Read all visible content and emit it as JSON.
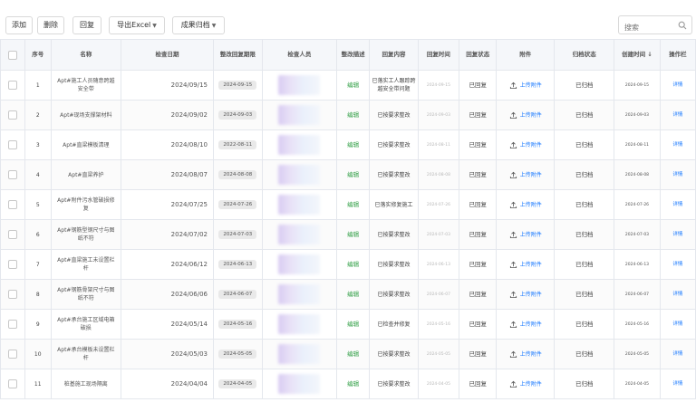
{
  "toolbar": {
    "add_label": "添加",
    "delete_label": "删除",
    "reply_label": "回复",
    "export_label": "导出Excel",
    "archive_label": "成果归档",
    "search_placeholder": "搜索"
  },
  "table": {
    "headers": {
      "index": "序号",
      "name": "名称",
      "check_date": "检查日期",
      "deadline": "整改回复期限",
      "inspector": "检查人员",
      "description": "整改描述",
      "reply_content": "回复内容",
      "reply_time": "回复时间",
      "reply_status": "回复状态",
      "attachment": "附件",
      "archive_status": "归档状态",
      "create_time": "创建时间 ↓",
      "actions": "操作栏"
    },
    "rows": [
      {
        "index": "1",
        "name": "Apt#施工人员随意跨越安全带",
        "check_date": "2024/09/15",
        "deadline": "2024-09-15",
        "description": "编辑",
        "reply": "已落实工人跟踪跨越安全带问题",
        "reply_time": "2024-09-15",
        "status": "已回复",
        "attachment": "上传附件",
        "archive": "已归档",
        "created": "2024-09-15",
        "action": "详情"
      },
      {
        "index": "2",
        "name": "Apt#现场支撑架材料",
        "check_date": "2024/09/02",
        "deadline": "2024-09-03",
        "description": "编辑",
        "reply": "已按要求整改",
        "reply_time": "2024-09-03",
        "status": "已回复",
        "attachment": "上传附件",
        "archive": "已归档",
        "created": "2024-09-03",
        "action": "详情"
      },
      {
        "index": "3",
        "name": "Apt#直梁模板清理",
        "check_date": "2024/08/10",
        "deadline": "2022-08-11",
        "description": "编辑",
        "reply": "已按要求整改",
        "reply_time": "2024-08-11",
        "status": "已回复",
        "attachment": "上传附件",
        "archive": "已归档",
        "created": "2024-08-11",
        "action": "详情"
      },
      {
        "index": "4",
        "name": "Apt#直梁养护",
        "check_date": "2024/08/07",
        "deadline": "2024-08-08",
        "description": "编辑",
        "reply": "已按要求整改",
        "reply_time": "2024-08-08",
        "status": "已回复",
        "attachment": "上传附件",
        "archive": "已归档",
        "created": "2024-08-08",
        "action": "详情"
      },
      {
        "index": "5",
        "name": "Apt#附件污水管破损修复",
        "check_date": "2024/07/25",
        "deadline": "2024-07-26",
        "description": "编辑",
        "reply": "已落实修复施工",
        "reply_time": "2024-07-26",
        "status": "已回复",
        "attachment": "上传附件",
        "archive": "已归档",
        "created": "2024-07-26",
        "action": "详情"
      },
      {
        "index": "6",
        "name": "Apt#钢筋型钢尺寸与图纸不符",
        "check_date": "2024/07/02",
        "deadline": "2024-07-03",
        "description": "编辑",
        "reply": "已按要求整改",
        "reply_time": "2024-07-03",
        "status": "已回复",
        "attachment": "上传附件",
        "archive": "已归档",
        "created": "2024-07-03",
        "action": "详情"
      },
      {
        "index": "7",
        "name": "Apt#直梁施工未设置栏杆",
        "check_date": "2024/06/12",
        "deadline": "2024-06-13",
        "description": "编辑",
        "reply": "已按要求整改",
        "reply_time": "2024-06-13",
        "status": "已回复",
        "attachment": "上传附件",
        "archive": "已归档",
        "created": "2024-06-13",
        "action": "详情"
      },
      {
        "index": "8",
        "name": "Apt#钢筋骨架尺寸与图纸不符",
        "check_date": "2024/06/06",
        "deadline": "2024-06-07",
        "description": "编辑",
        "reply": "已按要求整改",
        "reply_time": "2024-06-07",
        "status": "已回复",
        "attachment": "上传附件",
        "archive": "已归档",
        "created": "2024-06-07",
        "action": "详情"
      },
      {
        "index": "9",
        "name": "Apt#承台施工区域电箱破损",
        "check_date": "2024/05/14",
        "deadline": "2024-05-16",
        "description": "编辑",
        "reply": "已检查并修复",
        "reply_time": "2024-05-16",
        "status": "已回复",
        "attachment": "上传附件",
        "archive": "已归档",
        "created": "2024-05-16",
        "action": "详情"
      },
      {
        "index": "10",
        "name": "Apt#承台模板未设置栏杆",
        "check_date": "2024/05/03",
        "deadline": "2024-05-05",
        "description": "编辑",
        "reply": "已按要求整改",
        "reply_time": "2024-05-05",
        "status": "已回复",
        "attachment": "上传附件",
        "archive": "已归档",
        "created": "2024-05-05",
        "action": "详情"
      },
      {
        "index": "11",
        "name": "桩基施工现场隔离",
        "check_date": "2024/04/04",
        "deadline": "2024-04-05",
        "description": "编辑",
        "reply": "已按要求整改",
        "reply_time": "2024-04-05",
        "status": "已回复",
        "attachment": "上传附件",
        "archive": "已归档",
        "created": "2024-04-05",
        "action": "详情"
      }
    ]
  },
  "colors": {
    "link": "#1677ff",
    "edit": "#2f9e44",
    "header_bg": "#f5f7fa",
    "border": "#e4e7ed"
  }
}
